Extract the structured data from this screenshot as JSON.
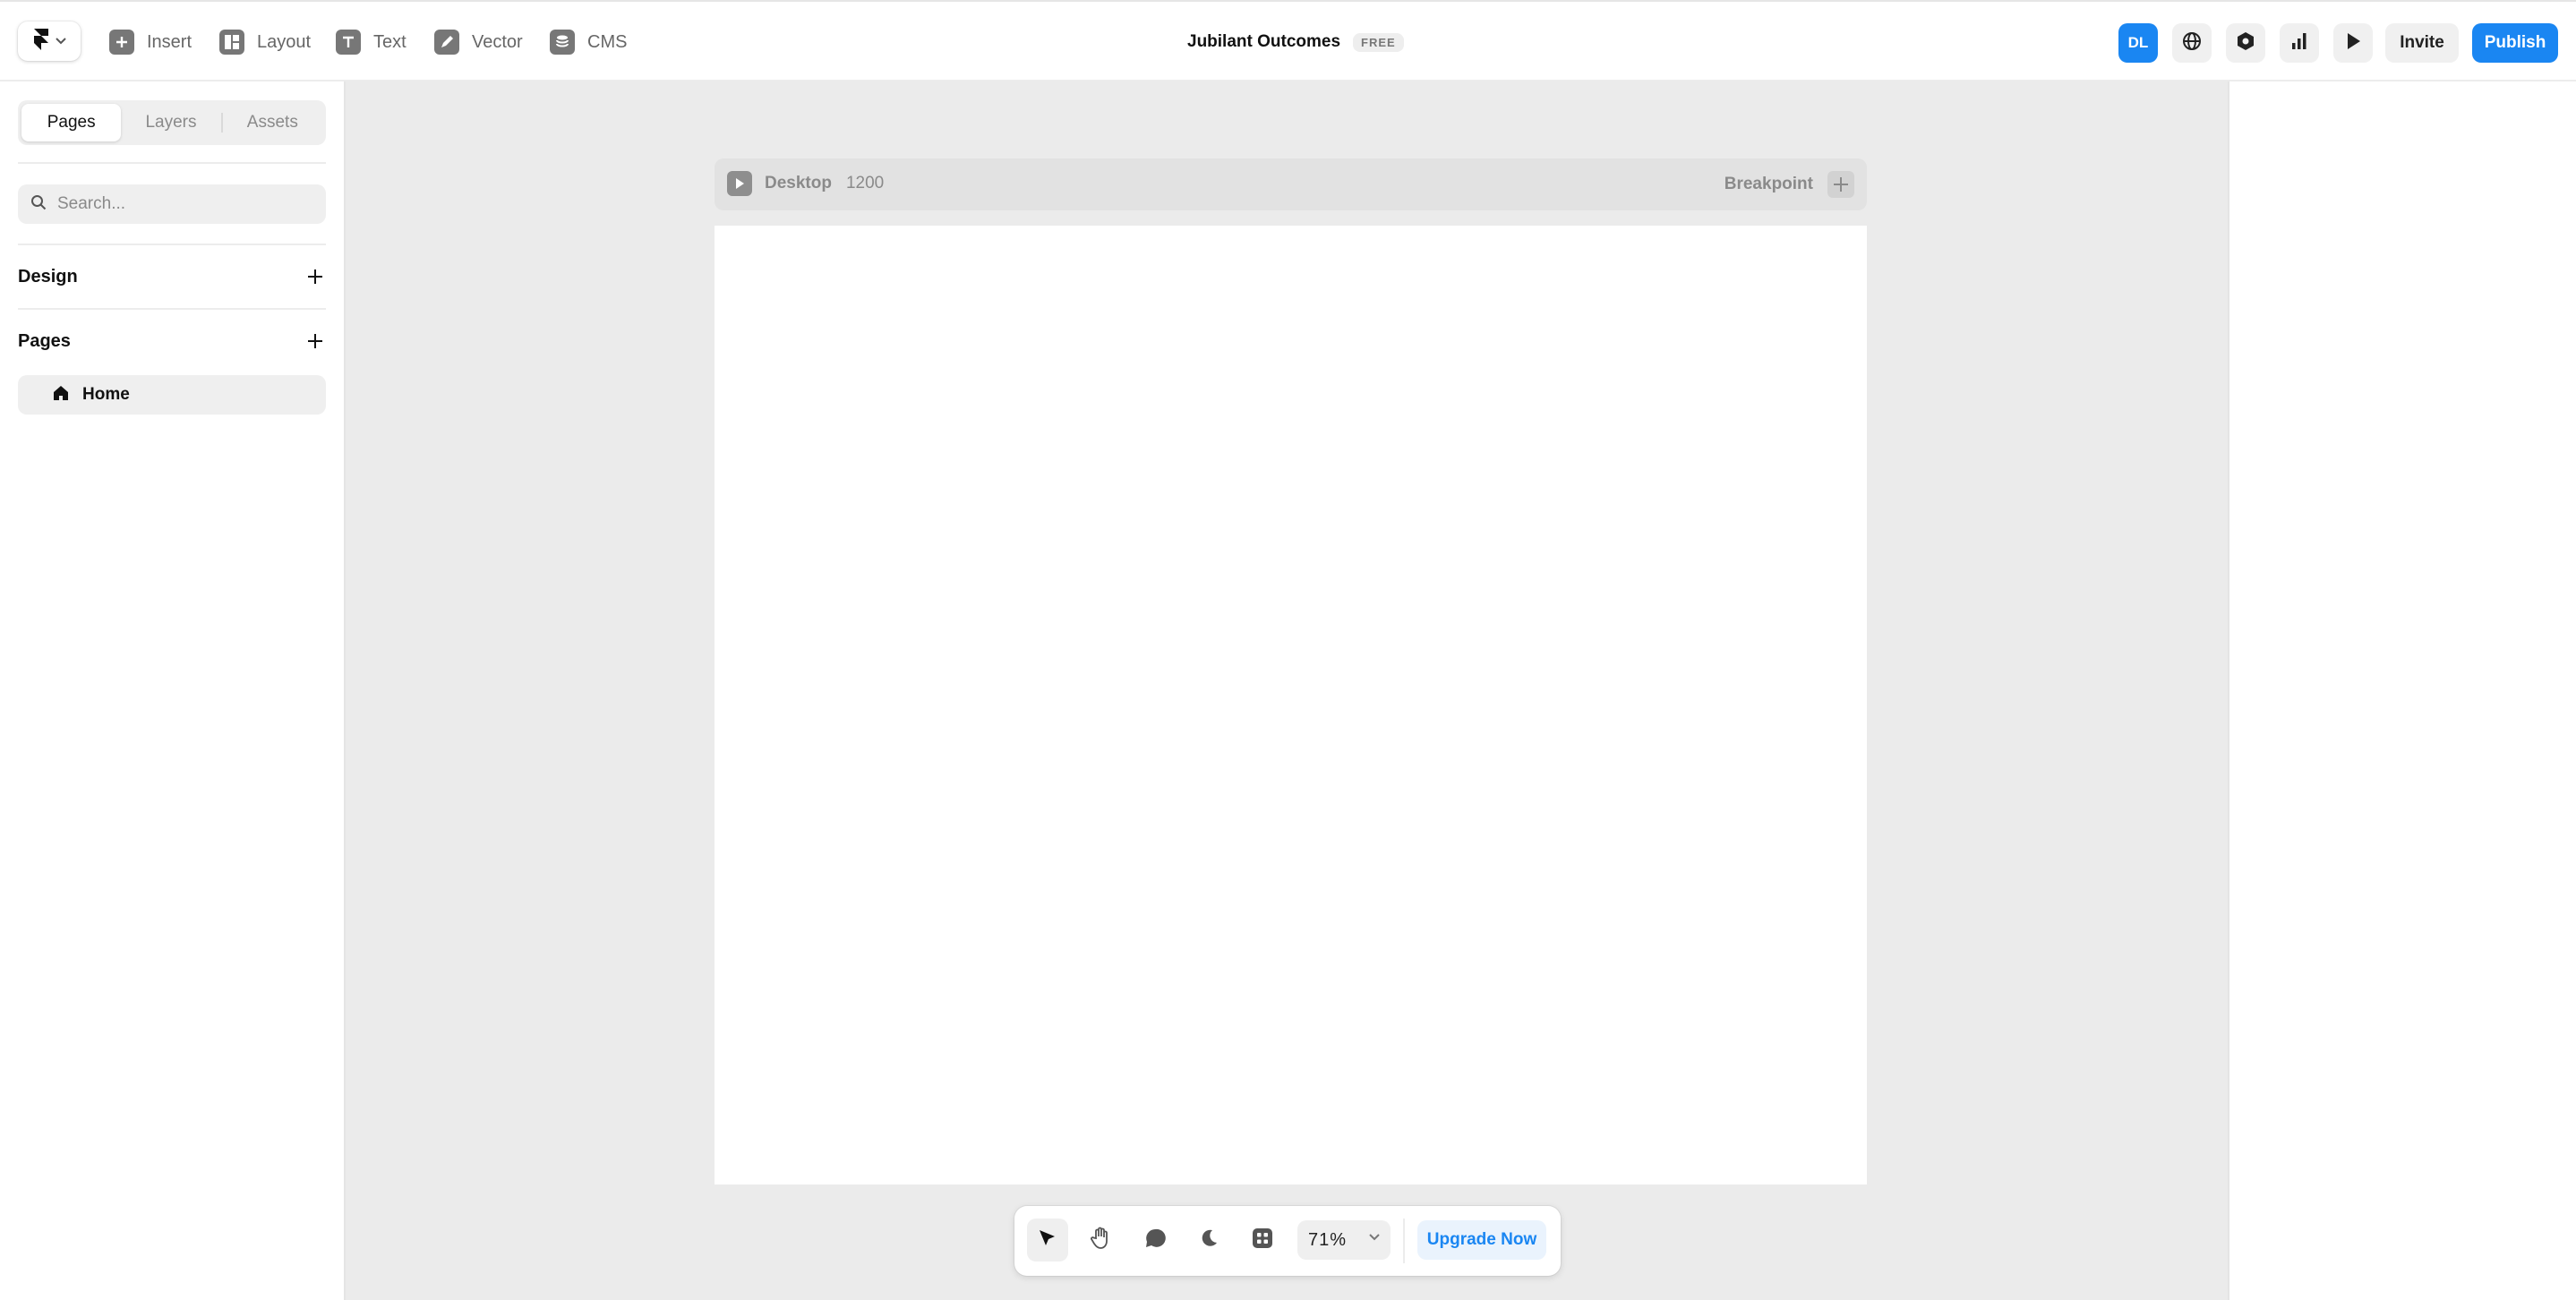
{
  "toolbar": {
    "tools": [
      {
        "label": "Insert",
        "icon": "plus-square-icon"
      },
      {
        "label": "Layout",
        "icon": "layout-icon"
      },
      {
        "label": "Text",
        "icon": "text-icon"
      },
      {
        "label": "Vector",
        "icon": "pen-icon"
      },
      {
        "label": "CMS",
        "icon": "database-icon"
      }
    ],
    "project_name": "Jubilant Outcomes",
    "plan_badge": "FREE",
    "avatar_initials": "DL",
    "invite_label": "Invite",
    "publish_label": "Publish"
  },
  "sidebar": {
    "tabs": [
      "Pages",
      "Layers",
      "Assets"
    ],
    "active_tab": "Pages",
    "search_placeholder": "Search...",
    "sections": {
      "design": "Design",
      "pages": "Pages"
    },
    "pages": [
      {
        "label": "Home",
        "icon": "home-icon"
      }
    ]
  },
  "canvas": {
    "breakpoint_name": "Desktop",
    "breakpoint_width": "1200",
    "breakpoint_label": "Breakpoint"
  },
  "bottom_toolbar": {
    "zoom": "71%",
    "upgrade_label": "Upgrade Now"
  },
  "colors": {
    "accent": "#1a86f2",
    "canvas_bg": "#ebebeb"
  }
}
